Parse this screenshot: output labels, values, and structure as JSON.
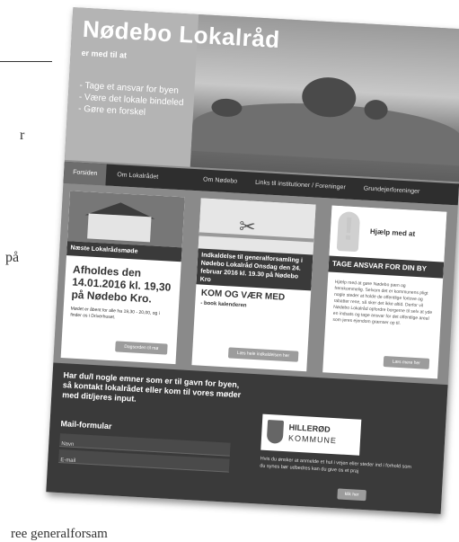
{
  "background": {
    "frag_r": "r",
    "frag_pa": "på",
    "bottom_text": "ree generalforsam"
  },
  "site": {
    "title": "Nødebo Lokalråd",
    "tagline": "er med til at",
    "bullets": [
      "- Tage et ansvar for byen",
      "- Være det lokale bindeled",
      "- Gøre en forskel"
    ]
  },
  "nav": {
    "items": [
      "Forsiden",
      "Om Lokalrådet",
      "Om Nødebo",
      "Links til institutioner / Foreninger",
      "Grundejerforeninger"
    ],
    "active_index": 0
  },
  "cards": {
    "card1": {
      "band": "Næste Lokalrådsmøde",
      "heading": "Afholdes den 14.01.2016 kl. 19,30 på Nødebo Kro.",
      "body": "Mødet er åbent for alle fra 19,30 - 20,00, og i finder os i Driverhuset.",
      "button": "Dagsorden til mø"
    },
    "card2": {
      "band": "Indkaldelse til generalforsamling i Nødebo Lokalråd Onsdag den 24. februar 2016 kl. 19.30 på Nødebo Kro",
      "heading": "KOM OG VÆR MED",
      "body": "- book kalenderen",
      "button": "Læs hele indkaldelsen her"
    },
    "card3": {
      "help_title": "Hjælp med at",
      "band": "TAGE ANSVAR FOR DIN BY",
      "body": "Hjælp med at gøre Nødebo pæn og fremkommelig. Selvom det er kommunens pligt nogle steder at holde de offentlige fortove og rabatter rene, så sker det ikke altid. Derfor vil Nødebo Lokalråd opfordre borgerne til selv at yde en indsats og tage ansvar for det offentlige areal som jeres ejendom grænser op til.",
      "button": "Læs mere her"
    }
  },
  "footer": {
    "text": "Har du/I nogle emner som er til gavn for byen, så kontakt lokalrådet eller kom til vores møder med dit/jeres input.",
    "form_title": "Mail-formular",
    "field_name": "Navn",
    "field_email": "E-mail",
    "logo_line1": "HILLERØD",
    "logo_line2": "KOMMUNE",
    "small_text": "Hvis du ønsker at anmelde et hul i vejen eller steder ind i forhold som du synes bør udbedres kan du give os et praj",
    "button": "klik her"
  }
}
